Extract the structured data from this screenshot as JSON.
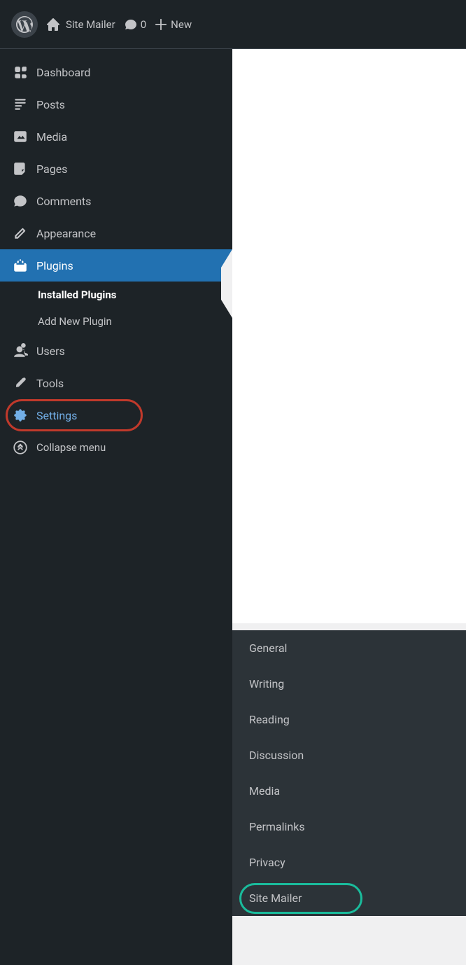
{
  "topbar": {
    "wp_logo_alt": "WordPress Logo",
    "site_name": "Site Mailer",
    "comments_count": "0",
    "new_label": "New"
  },
  "sidebar": {
    "items": [
      {
        "id": "dashboard",
        "label": "Dashboard",
        "icon": "dashboard"
      },
      {
        "id": "posts",
        "label": "Posts",
        "icon": "posts"
      },
      {
        "id": "media",
        "label": "Media",
        "icon": "media"
      },
      {
        "id": "pages",
        "label": "Pages",
        "icon": "pages"
      },
      {
        "id": "comments",
        "label": "Comments",
        "icon": "comments"
      },
      {
        "id": "appearance",
        "label": "Appearance",
        "icon": "appearance"
      },
      {
        "id": "plugins",
        "label": "Plugins",
        "icon": "plugins",
        "active": true
      },
      {
        "id": "users",
        "label": "Users",
        "icon": "users"
      },
      {
        "id": "tools",
        "label": "Tools",
        "icon": "tools"
      },
      {
        "id": "settings",
        "label": "Settings",
        "icon": "settings"
      }
    ],
    "plugins_submenu": [
      {
        "id": "installed-plugins",
        "label": "Installed Plugins",
        "active": true
      },
      {
        "id": "add-new-plugin",
        "label": "Add New Plugin"
      }
    ],
    "collapse_label": "Collapse menu"
  },
  "settings_submenu": {
    "items": [
      {
        "id": "general",
        "label": "General"
      },
      {
        "id": "writing",
        "label": "Writing"
      },
      {
        "id": "reading",
        "label": "Reading"
      },
      {
        "id": "discussion",
        "label": "Discussion"
      },
      {
        "id": "media",
        "label": "Media"
      },
      {
        "id": "permalinks",
        "label": "Permalinks"
      },
      {
        "id": "privacy",
        "label": "Privacy"
      },
      {
        "id": "site-mailer",
        "label": "Site Mailer"
      }
    ]
  }
}
